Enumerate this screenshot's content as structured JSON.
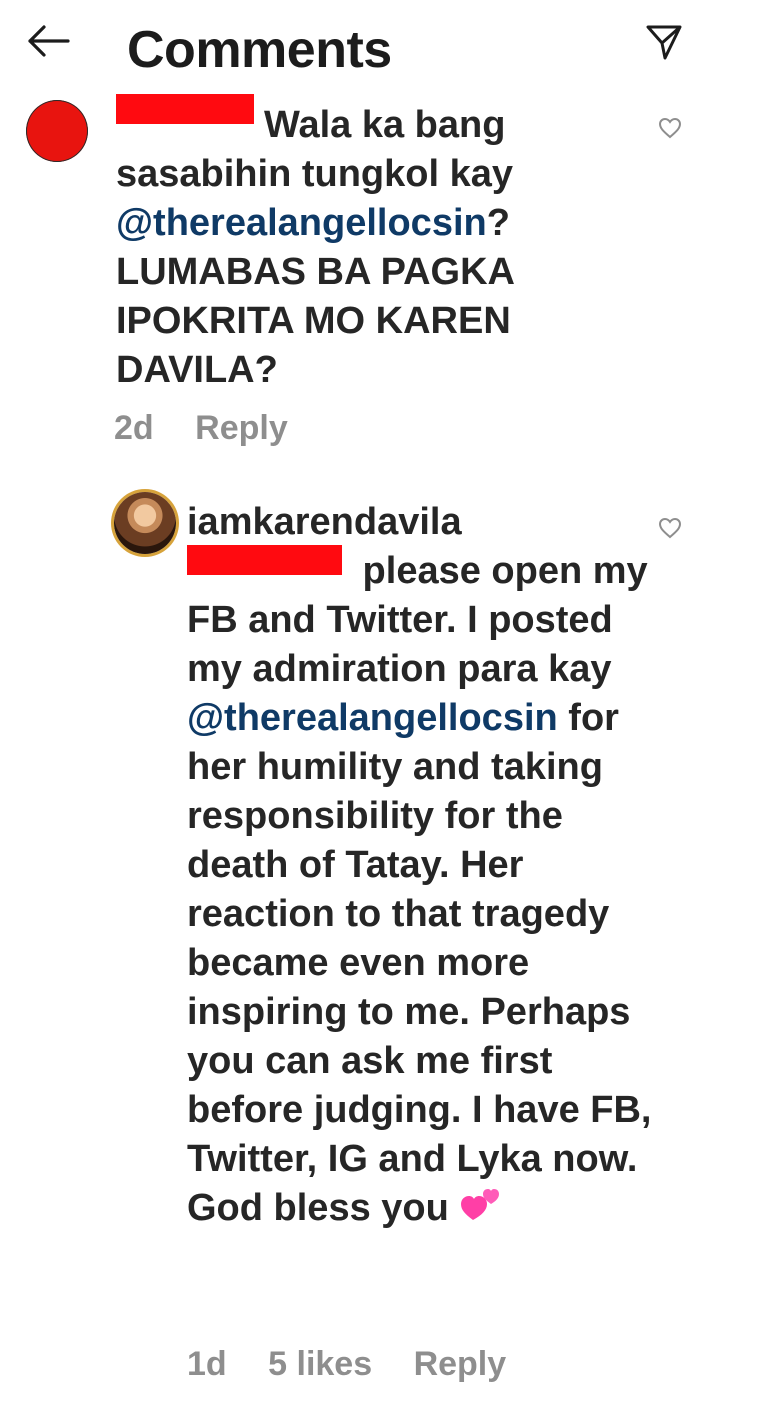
{
  "header": {
    "title": "Comments",
    "back_icon": "arrow-left-icon",
    "share_icon": "paper-plane-icon"
  },
  "comments": [
    {
      "avatar": "red-avatar",
      "username_redacted": true,
      "text_part1": "Wala ka bang sasabihin tungkol kay ",
      "mention": "@therealangellocsin",
      "text_part2": "? LUMABAS BA PAGKA IPOKRITA MO KAREN DAVILA?",
      "time": "2d",
      "reply_label": "Reply"
    },
    {
      "avatar": "profile-photo-avatar",
      "username": "iamkarendavila",
      "text_part1": " please open my FB and Twitter. I posted my admiration para kay ",
      "mention": "@therealangellocsin",
      "text_part2": " for her humility and taking responsibility for the death of Tatay. Her reaction to that tragedy became even more inspiring to me. Perhaps you can ask me first before judging. I have FB, Twitter, IG and Lyka now. God bless you ",
      "time": "1d",
      "likes": "5 likes",
      "reply_label": "Reply"
    }
  ],
  "colors": {
    "mention": "#0f3a66",
    "meta": "#8e8e8e",
    "redaction": "#ff0a10",
    "text": "#262626"
  }
}
